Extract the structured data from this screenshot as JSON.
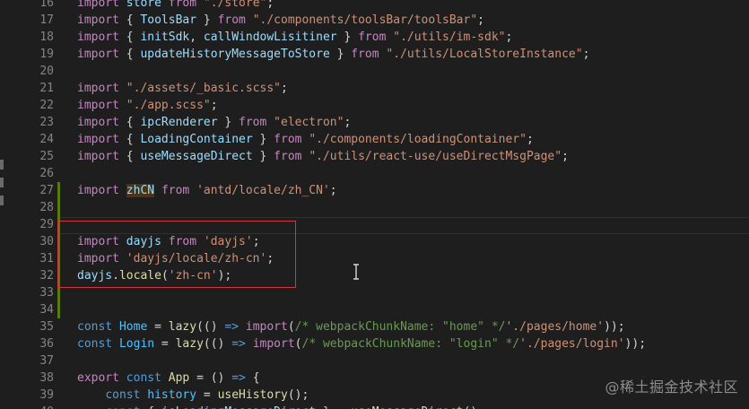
{
  "editor": {
    "lines": [
      {
        "n": "16",
        "mark": "",
        "tokens": [
          [
            "kw",
            "import"
          ],
          [
            "pu",
            " "
          ],
          [
            "var",
            "store"
          ],
          [
            "pu",
            " "
          ],
          [
            "kw",
            "from"
          ],
          [
            "pu",
            " "
          ],
          [
            "st",
            "\"./store\""
          ],
          [
            "pu",
            ";"
          ]
        ]
      },
      {
        "n": "17",
        "mark": "",
        "tokens": [
          [
            "kw",
            "import"
          ],
          [
            "pu",
            " { "
          ],
          [
            "var",
            "ToolsBar"
          ],
          [
            "pu",
            " } "
          ],
          [
            "kw",
            "from"
          ],
          [
            "pu",
            " "
          ],
          [
            "st",
            "\"./components/toolsBar/toolsBar\""
          ],
          [
            "pu",
            ";"
          ]
        ]
      },
      {
        "n": "18",
        "mark": "",
        "tokens": [
          [
            "kw",
            "import"
          ],
          [
            "pu",
            " { "
          ],
          [
            "var",
            "initSdk"
          ],
          [
            "pu",
            ", "
          ],
          [
            "var",
            "callWindowLisitiner"
          ],
          [
            "pu",
            " } "
          ],
          [
            "kw",
            "from"
          ],
          [
            "pu",
            " "
          ],
          [
            "st",
            "\"./utils/im-sdk\""
          ],
          [
            "pu",
            ";"
          ]
        ]
      },
      {
        "n": "19",
        "mark": "",
        "tokens": [
          [
            "kw",
            "import"
          ],
          [
            "pu",
            " { "
          ],
          [
            "var",
            "updateHistoryMessageToStore"
          ],
          [
            "pu",
            " } "
          ],
          [
            "kw",
            "from"
          ],
          [
            "pu",
            " "
          ],
          [
            "st",
            "\"./utils/LocalStoreInstance\""
          ],
          [
            "pu",
            ";"
          ]
        ]
      },
      {
        "n": "20",
        "mark": "",
        "tokens": []
      },
      {
        "n": "21",
        "mark": "",
        "tokens": [
          [
            "kw",
            "import"
          ],
          [
            "pu",
            " "
          ],
          [
            "st",
            "\"./assets/_basic.scss\""
          ],
          [
            "pu",
            ";"
          ]
        ]
      },
      {
        "n": "22",
        "mark": "",
        "tokens": [
          [
            "kw",
            "import"
          ],
          [
            "pu",
            " "
          ],
          [
            "st",
            "\"./app.scss\""
          ],
          [
            "pu",
            ";"
          ]
        ]
      },
      {
        "n": "23",
        "mark": "",
        "tokens": [
          [
            "kw",
            "import"
          ],
          [
            "pu",
            " { "
          ],
          [
            "var",
            "ipcRenderer"
          ],
          [
            "pu",
            " } "
          ],
          [
            "kw",
            "from"
          ],
          [
            "pu",
            " "
          ],
          [
            "st",
            "\"electron\""
          ],
          [
            "pu",
            ";"
          ]
        ]
      },
      {
        "n": "24",
        "mark": "",
        "tokens": [
          [
            "kw",
            "import"
          ],
          [
            "pu",
            " { "
          ],
          [
            "var",
            "LoadingContainer"
          ],
          [
            "pu",
            " } "
          ],
          [
            "kw",
            "from"
          ],
          [
            "pu",
            " "
          ],
          [
            "st",
            "\"./components/loadingContainer\""
          ],
          [
            "pu",
            ";"
          ]
        ]
      },
      {
        "n": "25",
        "mark": "",
        "tokens": [
          [
            "kw",
            "import"
          ],
          [
            "pu",
            " { "
          ],
          [
            "var",
            "useMessageDirect"
          ],
          [
            "pu",
            " } "
          ],
          [
            "kw",
            "from"
          ],
          [
            "pu",
            " "
          ],
          [
            "st",
            "\"./utils/react-use/useDirectMsgPage\""
          ],
          [
            "pu",
            ";"
          ]
        ]
      },
      {
        "n": "26",
        "mark": "",
        "tokens": []
      },
      {
        "n": "27",
        "mark": "added",
        "tokens": [
          [
            "kw",
            "import"
          ],
          [
            "pu",
            " "
          ],
          [
            "hl",
            "zhCN"
          ],
          [
            "pu",
            " "
          ],
          [
            "kw",
            "from"
          ],
          [
            "pu",
            " "
          ],
          [
            "st",
            "'antd/locale/zh_CN'"
          ],
          [
            "pu",
            ";"
          ]
        ]
      },
      {
        "n": "28",
        "mark": "added",
        "tokens": []
      },
      {
        "n": "29",
        "mark": "added",
        "tokens": []
      },
      {
        "n": "30",
        "mark": "added",
        "tokens": [
          [
            "kw",
            "import"
          ],
          [
            "pu",
            " "
          ],
          [
            "var",
            "dayjs"
          ],
          [
            "pu",
            " "
          ],
          [
            "kw",
            "from"
          ],
          [
            "pu",
            " "
          ],
          [
            "st",
            "'dayjs'"
          ],
          [
            "pu",
            ";"
          ]
        ]
      },
      {
        "n": "31",
        "mark": "added",
        "tokens": [
          [
            "kw",
            "import"
          ],
          [
            "pu",
            " "
          ],
          [
            "st",
            "'dayjs/locale/zh-cn'"
          ],
          [
            "pu",
            ";"
          ]
        ]
      },
      {
        "n": "32",
        "mark": "added",
        "tokens": [
          [
            "var",
            "dayjs"
          ],
          [
            "pu",
            "."
          ],
          [
            "fn",
            "locale"
          ],
          [
            "pu",
            "("
          ],
          [
            "st",
            "'zh-cn'"
          ],
          [
            "pu",
            ");"
          ]
        ]
      },
      {
        "n": "33",
        "mark": "added",
        "tokens": []
      },
      {
        "n": "34",
        "mark": "added",
        "tokens": []
      },
      {
        "n": "35",
        "mark": "",
        "tokens": [
          [
            "dk",
            "const"
          ],
          [
            "pu",
            " "
          ],
          [
            "sb",
            "Home"
          ],
          [
            "pu",
            " = "
          ],
          [
            "fn",
            "lazy"
          ],
          [
            "pu",
            "(() "
          ],
          [
            "dk",
            "=>"
          ],
          [
            "pu",
            " "
          ],
          [
            "kw",
            "import"
          ],
          [
            "pu",
            "("
          ],
          [
            "cm",
            "/* webpackChunkName: \"home\" */"
          ],
          [
            "st",
            "'./pages/home'"
          ],
          [
            "pu",
            "));"
          ]
        ]
      },
      {
        "n": "36",
        "mark": "",
        "tokens": [
          [
            "dk",
            "const"
          ],
          [
            "pu",
            " "
          ],
          [
            "sb",
            "Login"
          ],
          [
            "pu",
            " = "
          ],
          [
            "fn",
            "lazy"
          ],
          [
            "pu",
            "(() "
          ],
          [
            "dk",
            "=>"
          ],
          [
            "pu",
            " "
          ],
          [
            "kw",
            "import"
          ],
          [
            "pu",
            "("
          ],
          [
            "cm",
            "/* webpackChunkName: \"login\" */"
          ],
          [
            "st",
            "'./pages/login'"
          ],
          [
            "pu",
            "));"
          ]
        ]
      },
      {
        "n": "37",
        "mark": "",
        "tokens": []
      },
      {
        "n": "38",
        "mark": "",
        "tokens": [
          [
            "kw",
            "export"
          ],
          [
            "pu",
            " "
          ],
          [
            "dk",
            "const"
          ],
          [
            "pu",
            " "
          ],
          [
            "fn",
            "App"
          ],
          [
            "pu",
            " = () "
          ],
          [
            "dk",
            "=>"
          ],
          [
            "pu",
            " {"
          ]
        ]
      },
      {
        "n": "39",
        "mark": "",
        "tokens": [
          [
            "pu",
            "    "
          ],
          [
            "dk",
            "const"
          ],
          [
            "pu",
            " "
          ],
          [
            "sb",
            "history"
          ],
          [
            "pu",
            " = "
          ],
          [
            "fn",
            "useHistory"
          ],
          [
            "pu",
            "();"
          ]
        ]
      },
      {
        "n": "40",
        "mark": "",
        "tokens": [
          [
            "pu",
            "    "
          ],
          [
            "dk",
            "const"
          ],
          [
            "pu",
            " { "
          ],
          [
            "var",
            "isLoadingMessageDirect"
          ],
          [
            "pu",
            " } = "
          ],
          [
            "fn",
            "useMessageDirect"
          ],
          [
            "pu",
            "();"
          ]
        ]
      }
    ]
  },
  "watermark": "@稀土掘金技术社区",
  "colors": {
    "background": "#1e1e1e",
    "added_gutter": "#587c0c",
    "selection_box": "#d4373f",
    "line_number": "#858585"
  }
}
